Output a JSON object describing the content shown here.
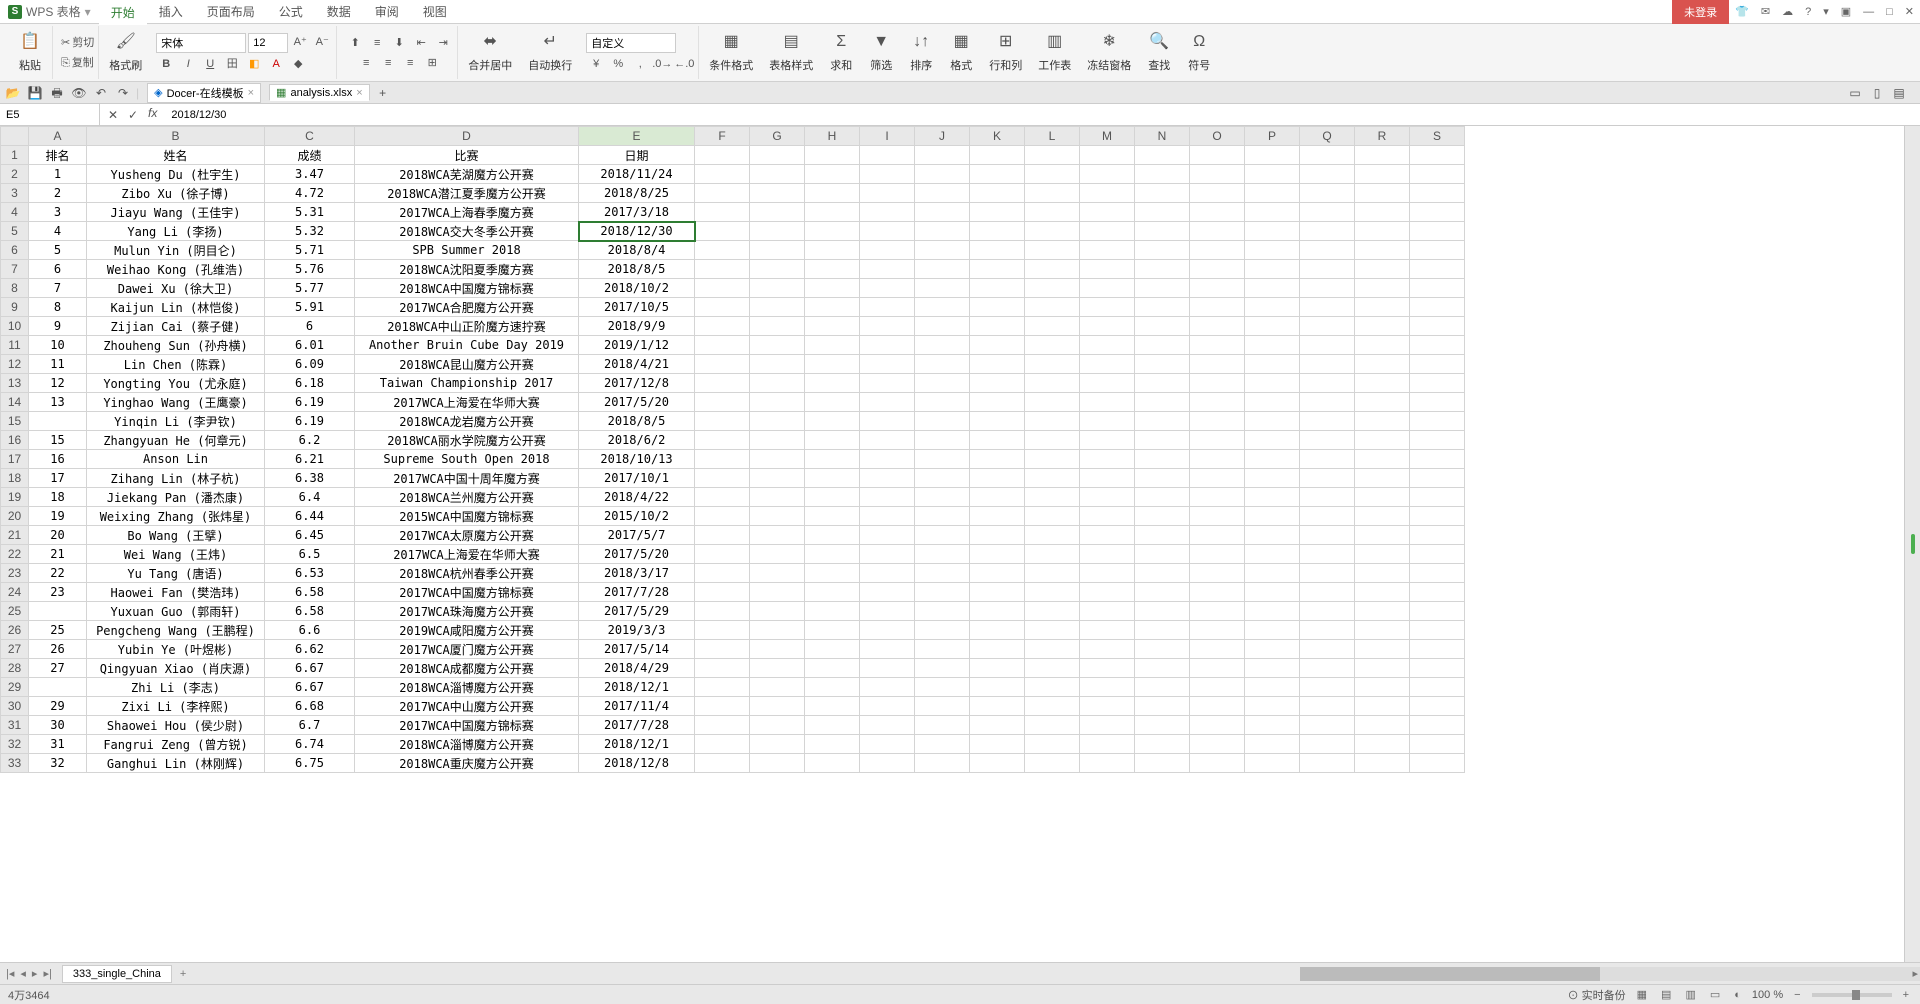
{
  "app": {
    "name": "WPS 表格"
  },
  "menus": [
    "开始",
    "插入",
    "页面布局",
    "公式",
    "数据",
    "审阅",
    "视图"
  ],
  "active_menu": 0,
  "login": {
    "not_logged": "未登录"
  },
  "ribbon": {
    "paste": "粘贴",
    "cut": "剪切",
    "copy": "复制",
    "format_painter": "格式刷",
    "font_name": "宋体",
    "font_size": "12",
    "number_format": "自定义",
    "merge_center": "合并居中",
    "wrap": "自动换行",
    "cond_fmt": "条件格式",
    "table_style": "表格样式",
    "sum": "求和",
    "filter": "筛选",
    "sort": "排序",
    "format": "格式",
    "row_col": "行和列",
    "worksheet": "工作表",
    "freeze": "冻结窗格",
    "find": "查找",
    "symbol": "符号"
  },
  "tabs": {
    "docer": "Docer-在线模板",
    "file": "analysis.xlsx"
  },
  "formula": {
    "cell_ref": "E5",
    "value": "2018/12/30"
  },
  "columns": [
    "A",
    "B",
    "C",
    "D",
    "E",
    "F",
    "G",
    "H",
    "I",
    "J",
    "K",
    "L",
    "M",
    "N",
    "O",
    "P",
    "Q",
    "R",
    "S"
  ],
  "headers": {
    "A": "排名",
    "B": "姓名",
    "C": "成绩",
    "D": "比赛",
    "E": "日期"
  },
  "selected": {
    "row": 5,
    "col": "E"
  },
  "rows": [
    {
      "r": "1",
      "A": "1",
      "B": "Yusheng Du (杜宇生)",
      "C": "3.47",
      "D": "2018WCA芜湖魔方公开赛",
      "E": "2018/11/24"
    },
    {
      "r": "2",
      "A": "2",
      "B": "Zibo Xu (徐子博)",
      "C": "4.72",
      "D": "2018WCA潜江夏季魔方公开赛",
      "E": "2018/8/25"
    },
    {
      "r": "3",
      "A": "3",
      "B": "Jiayu Wang (王佳宇)",
      "C": "5.31",
      "D": "2017WCA上海春季魔方赛",
      "E": "2017/3/18"
    },
    {
      "r": "4",
      "A": "4",
      "B": "Yang Li (李扬)",
      "C": "5.32",
      "D": "2018WCA交大冬季公开赛",
      "E": "2018/12/30"
    },
    {
      "r": "5",
      "A": "5",
      "B": "Mulun Yin (阴目仑)",
      "C": "5.71",
      "D": "SPB Summer 2018",
      "E": "2018/8/4"
    },
    {
      "r": "6",
      "A": "6",
      "B": "Weihao Kong (孔维浩)",
      "C": "5.76",
      "D": "2018WCA沈阳夏季魔方赛",
      "E": "2018/8/5"
    },
    {
      "r": "7",
      "A": "7",
      "B": "Dawei Xu (徐大卫)",
      "C": "5.77",
      "D": "2018WCA中国魔方锦标赛",
      "E": "2018/10/2"
    },
    {
      "r": "8",
      "A": "8",
      "B": "Kaijun Lin (林恺俊)",
      "C": "5.91",
      "D": "2017WCA合肥魔方公开赛",
      "E": "2017/10/5"
    },
    {
      "r": "9",
      "A": "9",
      "B": "Zijian Cai (蔡子健)",
      "C": "6",
      "D": "2018WCA中山正阶魔方速拧赛",
      "E": "2018/9/9"
    },
    {
      "r": "10",
      "A": "10",
      "B": "Zhouheng Sun (孙舟横)",
      "C": "6.01",
      "D": "Another Bruin Cube Day 2019",
      "E": "2019/1/12"
    },
    {
      "r": "11",
      "A": "11",
      "B": "Lin Chen (陈霖)",
      "C": "6.09",
      "D": "2018WCA昆山魔方公开赛",
      "E": "2018/4/21"
    },
    {
      "r": "12",
      "A": "12",
      "B": "Yongting You (尤永庭)",
      "C": "6.18",
      "D": "Taiwan Championship 2017",
      "E": "2017/12/8"
    },
    {
      "r": "13",
      "A": "13",
      "B": "Yinghao Wang (王鹰豪)",
      "C": "6.19",
      "D": "2017WCA上海爱在华师大赛",
      "E": "2017/5/20"
    },
    {
      "r": "14",
      "A": "",
      "B": "Yinqin Li (李尹钦)",
      "C": "6.19",
      "D": "2018WCA龙岩魔方公开赛",
      "E": "2018/8/5"
    },
    {
      "r": "15",
      "A": "15",
      "B": "Zhangyuan He (何章元)",
      "C": "6.2",
      "D": "2018WCA丽水学院魔方公开赛",
      "E": "2018/6/2"
    },
    {
      "r": "16",
      "A": "16",
      "B": "Anson Lin",
      "C": "6.21",
      "D": "Supreme South Open 2018",
      "E": "2018/10/13"
    },
    {
      "r": "17",
      "A": "17",
      "B": "Zihang Lin (林子杭)",
      "C": "6.38",
      "D": "2017WCA中国十周年魔方赛",
      "E": "2017/10/1"
    },
    {
      "r": "18",
      "A": "18",
      "B": "Jiekang Pan (潘杰康)",
      "C": "6.4",
      "D": "2018WCA兰州魔方公开赛",
      "E": "2018/4/22"
    },
    {
      "r": "19",
      "A": "19",
      "B": "Weixing Zhang (张炜星)",
      "C": "6.44",
      "D": "2015WCA中国魔方锦标赛",
      "E": "2015/10/2"
    },
    {
      "r": "20",
      "A": "20",
      "B": "Bo Wang (王擘)",
      "C": "6.45",
      "D": "2017WCA太原魔方公开赛",
      "E": "2017/5/7"
    },
    {
      "r": "21",
      "A": "21",
      "B": "Wei Wang (王炜)",
      "C": "6.5",
      "D": "2017WCA上海爱在华师大赛",
      "E": "2017/5/20"
    },
    {
      "r": "22",
      "A": "22",
      "B": "Yu Tang (唐语)",
      "C": "6.53",
      "D": "2018WCA杭州春季公开赛",
      "E": "2018/3/17"
    },
    {
      "r": "23",
      "A": "23",
      "B": "Haowei Fan (樊浩玮)",
      "C": "6.58",
      "D": "2017WCA中国魔方锦标赛",
      "E": "2017/7/28"
    },
    {
      "r": "24",
      "A": "",
      "B": "Yuxuan Guo (郭雨轩)",
      "C": "6.58",
      "D": "2017WCA珠海魔方公开赛",
      "E": "2017/5/29"
    },
    {
      "r": "25",
      "A": "25",
      "B": "Pengcheng Wang (王鹏程)",
      "C": "6.6",
      "D": "2019WCA咸阳魔方公开赛",
      "E": "2019/3/3"
    },
    {
      "r": "26",
      "A": "26",
      "B": "Yubin Ye (叶煜彬)",
      "C": "6.62",
      "D": "2017WCA厦门魔方公开赛",
      "E": "2017/5/14"
    },
    {
      "r": "27",
      "A": "27",
      "B": "Qingyuan Xiao (肖庆源)",
      "C": "6.67",
      "D": "2018WCA成都魔方公开赛",
      "E": "2018/4/29"
    },
    {
      "r": "28",
      "A": "",
      "B": "Zhi Li (李志)",
      "C": "6.67",
      "D": "2018WCA淄博魔方公开赛",
      "E": "2018/12/1"
    },
    {
      "r": "29",
      "A": "29",
      "B": "Zixi Li (李梓熙)",
      "C": "6.68",
      "D": "2017WCA中山魔方公开赛",
      "E": "2017/11/4"
    },
    {
      "r": "30",
      "A": "30",
      "B": "Shaowei Hou (侯少尉)",
      "C": "6.7",
      "D": "2017WCA中国魔方锦标赛",
      "E": "2017/7/28"
    },
    {
      "r": "31",
      "A": "31",
      "B": "Fangrui Zeng (曾方锐)",
      "C": "6.74",
      "D": "2018WCA淄博魔方公开赛",
      "E": "2018/12/1"
    },
    {
      "r": "32",
      "A": "32",
      "B": "Ganghui Lin (林刚辉)",
      "C": "6.75",
      "D": "2018WCA重庆魔方公开赛",
      "E": "2018/12/8"
    }
  ],
  "sheet_tab": "333_single_China",
  "status": {
    "count": "4万3464",
    "backup": "⊙ 实时备份",
    "zoom": "100 %"
  }
}
